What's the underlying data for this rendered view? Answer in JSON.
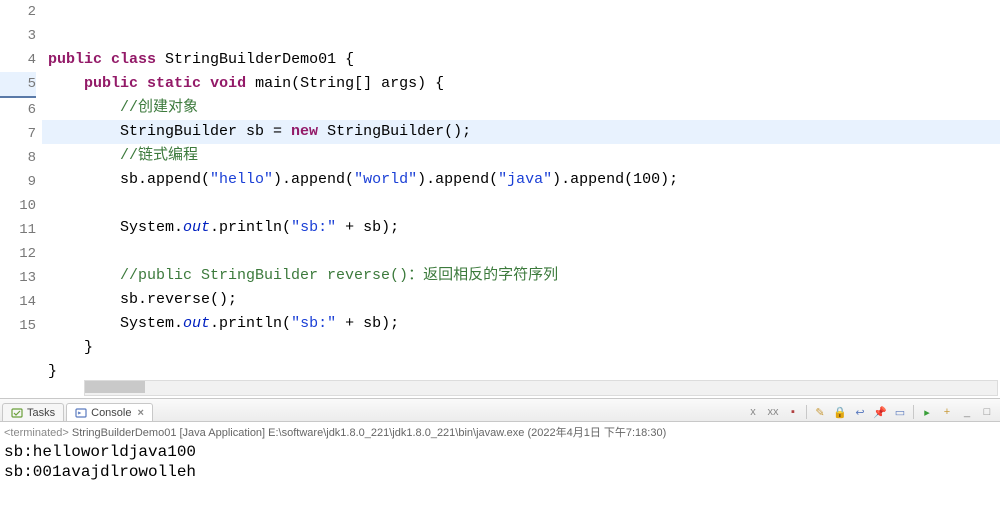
{
  "editor": {
    "highlighted_line": 5,
    "lines": [
      {
        "n": 2,
        "segs": [
          {
            "t": "public",
            "c": "kw"
          },
          {
            "t": " "
          },
          {
            "t": "class",
            "c": "kw"
          },
          {
            "t": " StringBuilderDemo01 {"
          }
        ]
      },
      {
        "n": 3,
        "segs": [
          {
            "t": "    "
          },
          {
            "t": "public",
            "c": "kw"
          },
          {
            "t": " "
          },
          {
            "t": "static",
            "c": "kw"
          },
          {
            "t": " "
          },
          {
            "t": "void",
            "c": "kw"
          },
          {
            "t": " main(String[] args) {"
          }
        ]
      },
      {
        "n": 4,
        "segs": [
          {
            "t": "        "
          },
          {
            "t": "//创建对象",
            "c": "cmt"
          }
        ]
      },
      {
        "n": 5,
        "segs": [
          {
            "t": "        StringBuilder sb = "
          },
          {
            "t": "new",
            "c": "kw"
          },
          {
            "t": " StringBuilder();"
          }
        ]
      },
      {
        "n": 6,
        "segs": [
          {
            "t": "        "
          },
          {
            "t": "//链式编程",
            "c": "cmt"
          }
        ]
      },
      {
        "n": 7,
        "segs": [
          {
            "t": "        sb.append("
          },
          {
            "t": "\"hello\"",
            "c": "str"
          },
          {
            "t": ").append("
          },
          {
            "t": "\"world\"",
            "c": "str"
          },
          {
            "t": ").append("
          },
          {
            "t": "\"java\"",
            "c": "str"
          },
          {
            "t": ").append(100);"
          }
        ]
      },
      {
        "n": 8,
        "segs": [
          {
            "t": ""
          }
        ]
      },
      {
        "n": 9,
        "segs": [
          {
            "t": "        System."
          },
          {
            "t": "out",
            "c": "stat"
          },
          {
            "t": ".println("
          },
          {
            "t": "\"sb:\"",
            "c": "str"
          },
          {
            "t": " + sb);"
          }
        ]
      },
      {
        "n": 10,
        "segs": [
          {
            "t": ""
          }
        ]
      },
      {
        "n": 11,
        "segs": [
          {
            "t": "        "
          },
          {
            "t": "//public StringBuilder reverse()：返回相反的字符序列",
            "c": "cmt"
          }
        ]
      },
      {
        "n": 12,
        "segs": [
          {
            "t": "        sb.reverse();"
          }
        ]
      },
      {
        "n": 13,
        "segs": [
          {
            "t": "        System."
          },
          {
            "t": "out",
            "c": "stat"
          },
          {
            "t": ".println("
          },
          {
            "t": "\"sb:\"",
            "c": "str"
          },
          {
            "t": " + sb);"
          }
        ]
      },
      {
        "n": 14,
        "segs": [
          {
            "t": "    }"
          }
        ]
      },
      {
        "n": 15,
        "segs": [
          {
            "t": "}"
          }
        ]
      }
    ]
  },
  "tabs": {
    "tasks": "Tasks",
    "console": "Console"
  },
  "console": {
    "status_prefix": "<terminated>",
    "status": "StringBuilderDemo01 [Java Application] E:\\software\\jdk1.8.0_221\\jdk1.8.0_221\\bin\\javaw.exe (2022年4月1日 下午7:18:30)",
    "output": [
      "sb:helloworldjava100",
      "sb:001avajdlrowolleh"
    ]
  },
  "toolbar_icons": [
    {
      "name": "remove-launch-icon",
      "glyph": "x",
      "color": "#888"
    },
    {
      "name": "remove-all-icon",
      "glyph": "xx",
      "color": "#888"
    },
    {
      "name": "terminate-icon",
      "glyph": "▪",
      "color": "#b04040"
    },
    {
      "name": "sep"
    },
    {
      "name": "clear-icon",
      "glyph": "✎",
      "color": "#c89a3a"
    },
    {
      "name": "scroll-lock-icon",
      "glyph": "🔒",
      "color": "#888"
    },
    {
      "name": "word-wrap-icon",
      "glyph": "↩",
      "color": "#5a7abf"
    },
    {
      "name": "pin-console-icon",
      "glyph": "📌",
      "color": "#5a7abf"
    },
    {
      "name": "display-selected-icon",
      "glyph": "▭",
      "color": "#5a7abf"
    },
    {
      "name": "sep"
    },
    {
      "name": "open-console-icon",
      "glyph": "▸",
      "color": "#3a9f3a"
    },
    {
      "name": "new-console-icon",
      "glyph": "+",
      "color": "#c89a3a"
    },
    {
      "name": "minimize-icon",
      "glyph": "_",
      "color": "#888"
    },
    {
      "name": "maximize-icon",
      "glyph": "□",
      "color": "#888"
    }
  ]
}
